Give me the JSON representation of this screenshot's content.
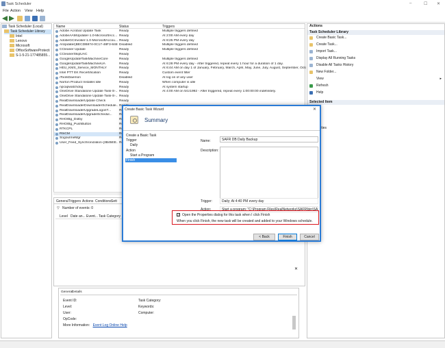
{
  "window": {
    "title": "Task Scheduler",
    "minimize": "–",
    "maximize": "☐",
    "close": "✕"
  },
  "menu": [
    "File",
    "Action",
    "View",
    "Help"
  ],
  "tree": [
    {
      "label": "Task Scheduler (Local)",
      "indent": 0
    },
    {
      "label": "Task Scheduler Library",
      "indent": 1,
      "selected": true
    },
    {
      "label": "Intel",
      "indent": 2
    },
    {
      "label": "Lenovo",
      "indent": 2
    },
    {
      "label": "Microsoft",
      "indent": 2
    },
    {
      "label": "OfficeSoftwareProtecti",
      "indent": 2
    },
    {
      "label": "S-1-5-21-177485855...",
      "indent": 2
    }
  ],
  "columns": {
    "name": "Name",
    "status": "Status",
    "triggers": "Triggers"
  },
  "tasks": [
    {
      "name": "Adobe Acrobat Update Task",
      "status": "Ready",
      "triggers": "Multiple triggers defined"
    },
    {
      "name": "AdobeAAMUpdater-1.0-MicrosoftAcc...",
      "status": "Ready",
      "triggers": "At 2:00 AM every day"
    },
    {
      "name": "AdobeGCInvoker-1.0-MicrosoftAccou...",
      "status": "Ready",
      "triggers": "At 8:25 PM every day"
    },
    {
      "name": "AIUpdater{BECDB874-0C17-48F3-848...",
      "status": "Disabled",
      "triggers": "Multiple triggers defined"
    },
    {
      "name": "CCleaner Update",
      "status": "Ready",
      "triggers": "Multiple triggers defined"
    },
    {
      "name": "CCleanerSkipUAC",
      "status": "Ready",
      "triggers": ""
    },
    {
      "name": "GoogleUpdateTaskMachineCore",
      "status": "Ready",
      "triggers": "Multiple triggers defined"
    },
    {
      "name": "GoogleUpdateTaskMachineUA",
      "status": "Ready",
      "triggers": "At 6:28 PM every day - After triggered, repeat every 1 hour for a duration of 1 day."
    },
    {
      "name": "HEU_KMS_Service_MONTHLY",
      "status": "Ready",
      "triggers": "At 6:44 AM on day 1 of January, February, March, April, May, June, July, August, September, Octob"
    },
    {
      "name": "Intel PTT EK Recertification",
      "status": "Ready",
      "triggers": "Custom event filter"
    },
    {
      "name": "iToolsDaemon",
      "status": "Disabled",
      "triggers": "At log on of any user"
    },
    {
      "name": "Norton Product Installer.Idle",
      "status": "Ready",
      "triggers": "When computer is idle"
    },
    {
      "name": "npcapwatchdog",
      "status": "Ready",
      "triggers": "At system startup"
    },
    {
      "name": "OneDrive Standalone Update Task-S-...",
      "status": "Ready",
      "triggers": "At 4:00 AM on 5/1/1992 - After triggered, repeat every 1:00:00:00 indefinitely."
    },
    {
      "name": "OneDrive Standalone Update Task-S-...",
      "status": "Ready",
      "triggers": ""
    },
    {
      "name": "RealDownloaderUpdate Check",
      "status": "Ready",
      "triggers": ""
    },
    {
      "name": "RealDownloaderDownloaderSchedule...",
      "status": "Ready",
      "triggers": ""
    },
    {
      "name": "RealDownloaderUpgradeLogonT...",
      "status": "Ready",
      "triggers": ""
    },
    {
      "name": "RealDownloaderUpgradeSchedul...",
      "status": "Ready",
      "triggers": ""
    },
    {
      "name": "RHO/Bg_Dolby",
      "status": "Ready",
      "triggers": ""
    },
    {
      "name": "RHO/Bg_PushButton",
      "status": "Ready",
      "triggers": ""
    },
    {
      "name": "RTKCPL",
      "status": "Ready",
      "triggers": ""
    },
    {
      "name": "RtsCM",
      "status": "Ready",
      "triggers": "",
      "selected": true
    },
    {
      "name": "SogouImeMgr",
      "status": "Ready",
      "triggers": ""
    },
    {
      "name": "User_Feed_Synchronization-{3B45EE...",
      "status": "Ready",
      "triggers": ""
    }
  ],
  "detail": {
    "tabs": [
      "General",
      "Triggers",
      "Actions",
      "Conditions",
      "Sett"
    ],
    "number_of_events": "Number of events: 0",
    "event_columns": [
      "Level",
      "Date an...",
      "Event...",
      "Task Category"
    ]
  },
  "event_panel": {
    "tabs": [
      "General",
      "Details"
    ],
    "fields": [
      "Event ID:",
      "Level:",
      "User:",
      "OpCode:",
      "More Information:"
    ],
    "fields_right": [
      "Task Category:",
      "Keywords:",
      "Computer:"
    ],
    "link": "Event Log Online Help",
    "close": "✕"
  },
  "actions": {
    "header": "Actions",
    "section1": "Task Scheduler Library",
    "items1": [
      "Create Basic Task...",
      "Create Task...",
      "Import Task...",
      "Display All Running Tasks",
      "Disable All Tasks History",
      "New Folder...",
      "View",
      "Refresh",
      "Help"
    ],
    "section2": "Selected Item",
    "items2": [
      "",
      "ble",
      "rt...",
      "perties",
      "te",
      ""
    ]
  },
  "wizard": {
    "title": "Create Basic Task Wizard",
    "close": "✕",
    "heading": "Summary",
    "nav": [
      {
        "label": "Create a Basic Task",
        "indent": 0
      },
      {
        "label": "Trigger",
        "indent": 0
      },
      {
        "label": "Daily",
        "indent": 1
      },
      {
        "label": "Action",
        "indent": 0
      },
      {
        "label": "Start a Program",
        "indent": 1
      },
      {
        "label": "Finish",
        "indent": 0,
        "selected": true
      }
    ],
    "name_label": "Name:",
    "name_value": "SAFR DB Daily Backup",
    "description_label": "Description:",
    "description_value": "",
    "trigger_label": "Trigger:",
    "trigger_value": "Daily; At 4:40 PM every day",
    "action_label": "Action:",
    "action_value": "Start a program; \"C:\\Program Files\\RealNetworks\\SAFR\\bin\\SAFR DB Back",
    "checkbox_label": "Open the Properties dialog for this task when I click Finish",
    "checkbox_checked": "✓",
    "hint": "When you click Finish, the new task will be created and added to your Windows schedule.",
    "back": "< Back",
    "finish": "Finish",
    "cancel": "Cancel"
  }
}
